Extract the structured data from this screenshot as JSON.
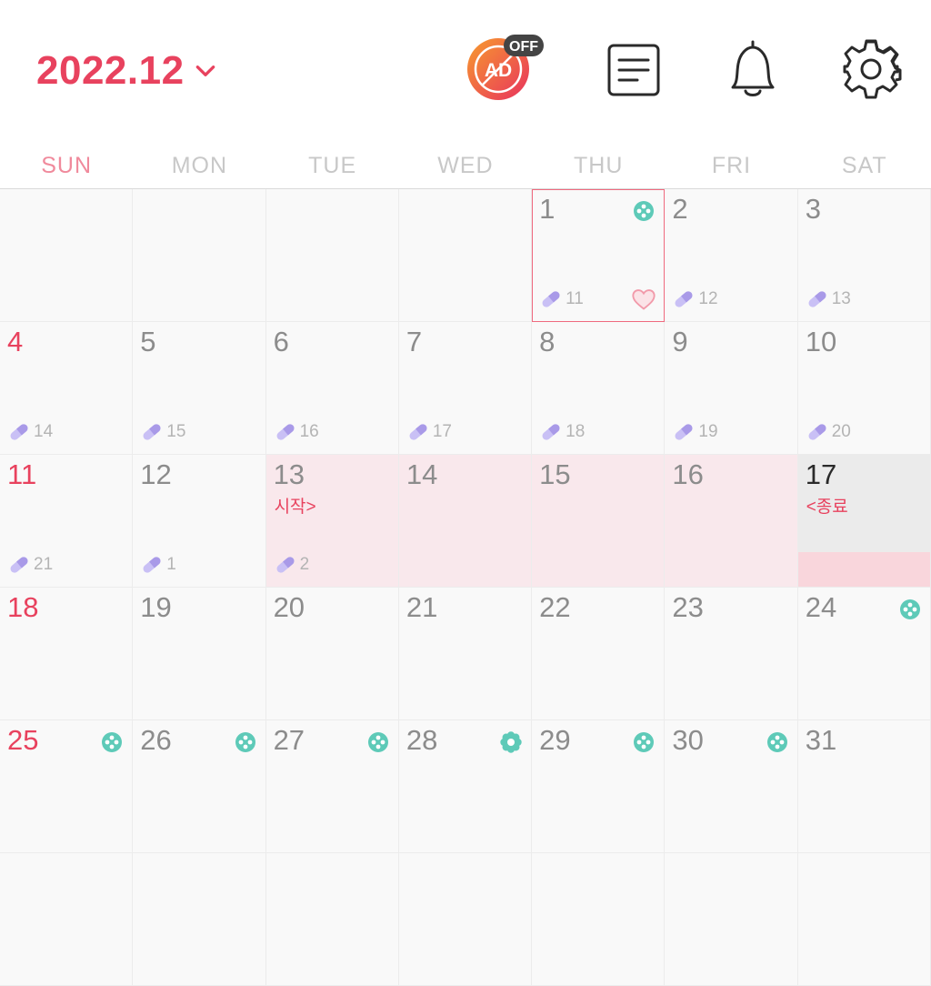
{
  "header": {
    "month_label": "2022.12",
    "ad_label": "AD",
    "ad_badge": "OFF"
  },
  "weekdays": [
    "SUN",
    "MON",
    "TUE",
    "WED",
    "THU",
    "FRI",
    "SAT"
  ],
  "colors": {
    "accent": "#e8425e",
    "period_bg": "#f9e8ec",
    "pill": "#b9aef0",
    "flower": "#5ecab8"
  },
  "calendar": {
    "cells": [
      {
        "day": "",
        "pill": "",
        "note": "",
        "flower": "",
        "heart": false,
        "period": false,
        "today": false,
        "selected": false
      },
      {
        "day": "",
        "pill": "",
        "note": "",
        "flower": "",
        "heart": false,
        "period": false,
        "today": false,
        "selected": false
      },
      {
        "day": "",
        "pill": "",
        "note": "",
        "flower": "",
        "heart": false,
        "period": false,
        "today": false,
        "selected": false
      },
      {
        "day": "",
        "pill": "",
        "note": "",
        "flower": "",
        "heart": false,
        "period": false,
        "today": false,
        "selected": false
      },
      {
        "day": "1",
        "pill": "11",
        "note": "",
        "flower": "dots",
        "heart": true,
        "period": false,
        "today": false,
        "selected": true
      },
      {
        "day": "2",
        "pill": "12",
        "note": "",
        "flower": "",
        "heart": false,
        "period": false,
        "today": false,
        "selected": false
      },
      {
        "day": "3",
        "pill": "13",
        "note": "",
        "flower": "",
        "heart": false,
        "period": false,
        "today": false,
        "selected": false
      },
      {
        "day": "4",
        "pill": "14",
        "note": "",
        "flower": "",
        "heart": false,
        "period": false,
        "today": false,
        "selected": false
      },
      {
        "day": "5",
        "pill": "15",
        "note": "",
        "flower": "",
        "heart": false,
        "period": false,
        "today": false,
        "selected": false
      },
      {
        "day": "6",
        "pill": "16",
        "note": "",
        "flower": "",
        "heart": false,
        "period": false,
        "today": false,
        "selected": false
      },
      {
        "day": "7",
        "pill": "17",
        "note": "",
        "flower": "",
        "heart": false,
        "period": false,
        "today": false,
        "selected": false
      },
      {
        "day": "8",
        "pill": "18",
        "note": "",
        "flower": "",
        "heart": false,
        "period": false,
        "today": false,
        "selected": false
      },
      {
        "day": "9",
        "pill": "19",
        "note": "",
        "flower": "",
        "heart": false,
        "period": false,
        "today": false,
        "selected": false
      },
      {
        "day": "10",
        "pill": "20",
        "note": "",
        "flower": "",
        "heart": false,
        "period": false,
        "today": false,
        "selected": false
      },
      {
        "day": "11",
        "pill": "21",
        "note": "",
        "flower": "",
        "heart": false,
        "period": false,
        "today": false,
        "selected": false
      },
      {
        "day": "12",
        "pill": "1",
        "note": "",
        "flower": "",
        "heart": false,
        "period": false,
        "today": false,
        "selected": false
      },
      {
        "day": "13",
        "pill": "2",
        "note": "시작>",
        "flower": "",
        "heart": false,
        "period": true,
        "today": false,
        "selected": false
      },
      {
        "day": "14",
        "pill": "",
        "note": "",
        "flower": "",
        "heart": false,
        "period": true,
        "today": false,
        "selected": false
      },
      {
        "day": "15",
        "pill": "",
        "note": "",
        "flower": "",
        "heart": false,
        "period": true,
        "today": false,
        "selected": false
      },
      {
        "day": "16",
        "pill": "",
        "note": "",
        "flower": "",
        "heart": false,
        "period": true,
        "today": false,
        "selected": false
      },
      {
        "day": "17",
        "pill": "",
        "note": "<종료",
        "flower": "",
        "heart": false,
        "period": false,
        "today": true,
        "selected": false
      },
      {
        "day": "18",
        "pill": "",
        "note": "",
        "flower": "",
        "heart": false,
        "period": false,
        "today": false,
        "selected": false
      },
      {
        "day": "19",
        "pill": "",
        "note": "",
        "flower": "",
        "heart": false,
        "period": false,
        "today": false,
        "selected": false
      },
      {
        "day": "20",
        "pill": "",
        "note": "",
        "flower": "",
        "heart": false,
        "period": false,
        "today": false,
        "selected": false
      },
      {
        "day": "21",
        "pill": "",
        "note": "",
        "flower": "",
        "heart": false,
        "period": false,
        "today": false,
        "selected": false
      },
      {
        "day": "22",
        "pill": "",
        "note": "",
        "flower": "",
        "heart": false,
        "period": false,
        "today": false,
        "selected": false
      },
      {
        "day": "23",
        "pill": "",
        "note": "",
        "flower": "",
        "heart": false,
        "period": false,
        "today": false,
        "selected": false
      },
      {
        "day": "24",
        "pill": "",
        "note": "",
        "flower": "dots",
        "heart": false,
        "period": false,
        "today": false,
        "selected": false
      },
      {
        "day": "25",
        "pill": "",
        "note": "",
        "flower": "dots",
        "heart": false,
        "period": false,
        "today": false,
        "selected": false
      },
      {
        "day": "26",
        "pill": "",
        "note": "",
        "flower": "dots",
        "heart": false,
        "period": false,
        "today": false,
        "selected": false
      },
      {
        "day": "27",
        "pill": "",
        "note": "",
        "flower": "dots",
        "heart": false,
        "period": false,
        "today": false,
        "selected": false
      },
      {
        "day": "28",
        "pill": "",
        "note": "",
        "flower": "filled",
        "heart": false,
        "period": false,
        "today": false,
        "selected": false
      },
      {
        "day": "29",
        "pill": "",
        "note": "",
        "flower": "dots",
        "heart": false,
        "period": false,
        "today": false,
        "selected": false
      },
      {
        "day": "30",
        "pill": "",
        "note": "",
        "flower": "dots",
        "heart": false,
        "period": false,
        "today": false,
        "selected": false
      },
      {
        "day": "31",
        "pill": "",
        "note": "",
        "flower": "",
        "heart": false,
        "period": false,
        "today": false,
        "selected": false
      },
      {
        "day": "",
        "pill": "",
        "note": "",
        "flower": "",
        "heart": false,
        "period": false,
        "today": false,
        "selected": false
      },
      {
        "day": "",
        "pill": "",
        "note": "",
        "flower": "",
        "heart": false,
        "period": false,
        "today": false,
        "selected": false
      },
      {
        "day": "",
        "pill": "",
        "note": "",
        "flower": "",
        "heart": false,
        "period": false,
        "today": false,
        "selected": false
      },
      {
        "day": "",
        "pill": "",
        "note": "",
        "flower": "",
        "heart": false,
        "period": false,
        "today": false,
        "selected": false
      },
      {
        "day": "",
        "pill": "",
        "note": "",
        "flower": "",
        "heart": false,
        "period": false,
        "today": false,
        "selected": false
      },
      {
        "day": "",
        "pill": "",
        "note": "",
        "flower": "",
        "heart": false,
        "period": false,
        "today": false,
        "selected": false
      },
      {
        "day": "",
        "pill": "",
        "note": "",
        "flower": "",
        "heart": false,
        "period": false,
        "today": false,
        "selected": false
      }
    ]
  }
}
